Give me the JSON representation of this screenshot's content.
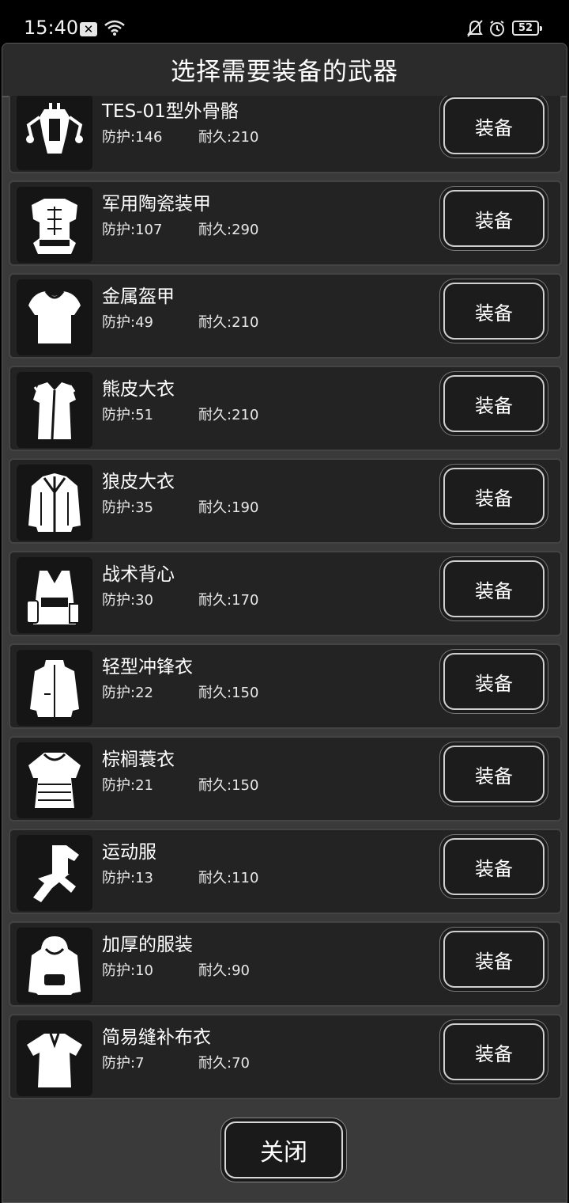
{
  "status_bar": {
    "time": "15:40",
    "notif_glyph": "✕",
    "battery": "52"
  },
  "dialog": {
    "title": "选择需要装备的武器",
    "close_label": "关闭"
  },
  "items": [
    {
      "name": "TES-01型外骨骼",
      "defense": "防护:146",
      "durability": "耐久:210",
      "equip_label": "装备",
      "icon": "exoskeleton-icon"
    },
    {
      "name": "军用陶瓷装甲",
      "defense": "防护:107",
      "durability": "耐久:290",
      "equip_label": "装备",
      "icon": "ceramic-armor-icon"
    },
    {
      "name": "金属盔甲",
      "defense": "防护:49",
      "durability": "耐久:210",
      "equip_label": "装备",
      "icon": "metal-armor-icon"
    },
    {
      "name": "熊皮大衣",
      "defense": "防护:51",
      "durability": "耐久:210",
      "equip_label": "装备",
      "icon": "bear-coat-icon"
    },
    {
      "name": "狼皮大衣",
      "defense": "防护:35",
      "durability": "耐久:190",
      "equip_label": "装备",
      "icon": "wolf-coat-icon"
    },
    {
      "name": "战术背心",
      "defense": "防护:30",
      "durability": "耐久:170",
      "equip_label": "装备",
      "icon": "tactical-vest-icon"
    },
    {
      "name": "轻型冲锋衣",
      "defense": "防护:22",
      "durability": "耐久:150",
      "equip_label": "装备",
      "icon": "jacket-icon"
    },
    {
      "name": "棕榈蓑衣",
      "defense": "防护:21",
      "durability": "耐久:150",
      "equip_label": "装备",
      "icon": "palm-raincoat-icon"
    },
    {
      "name": "运动服",
      "defense": "防护:13",
      "durability": "耐久:110",
      "equip_label": "装备",
      "icon": "tracksuit-icon"
    },
    {
      "name": "加厚的服装",
      "defense": "防护:10",
      "durability": "耐久:90",
      "equip_label": "装备",
      "icon": "hoodie-icon"
    },
    {
      "name": "简易缝补布衣",
      "defense": "防护:7",
      "durability": "耐久:70",
      "equip_label": "装备",
      "icon": "shirt-icon"
    }
  ]
}
